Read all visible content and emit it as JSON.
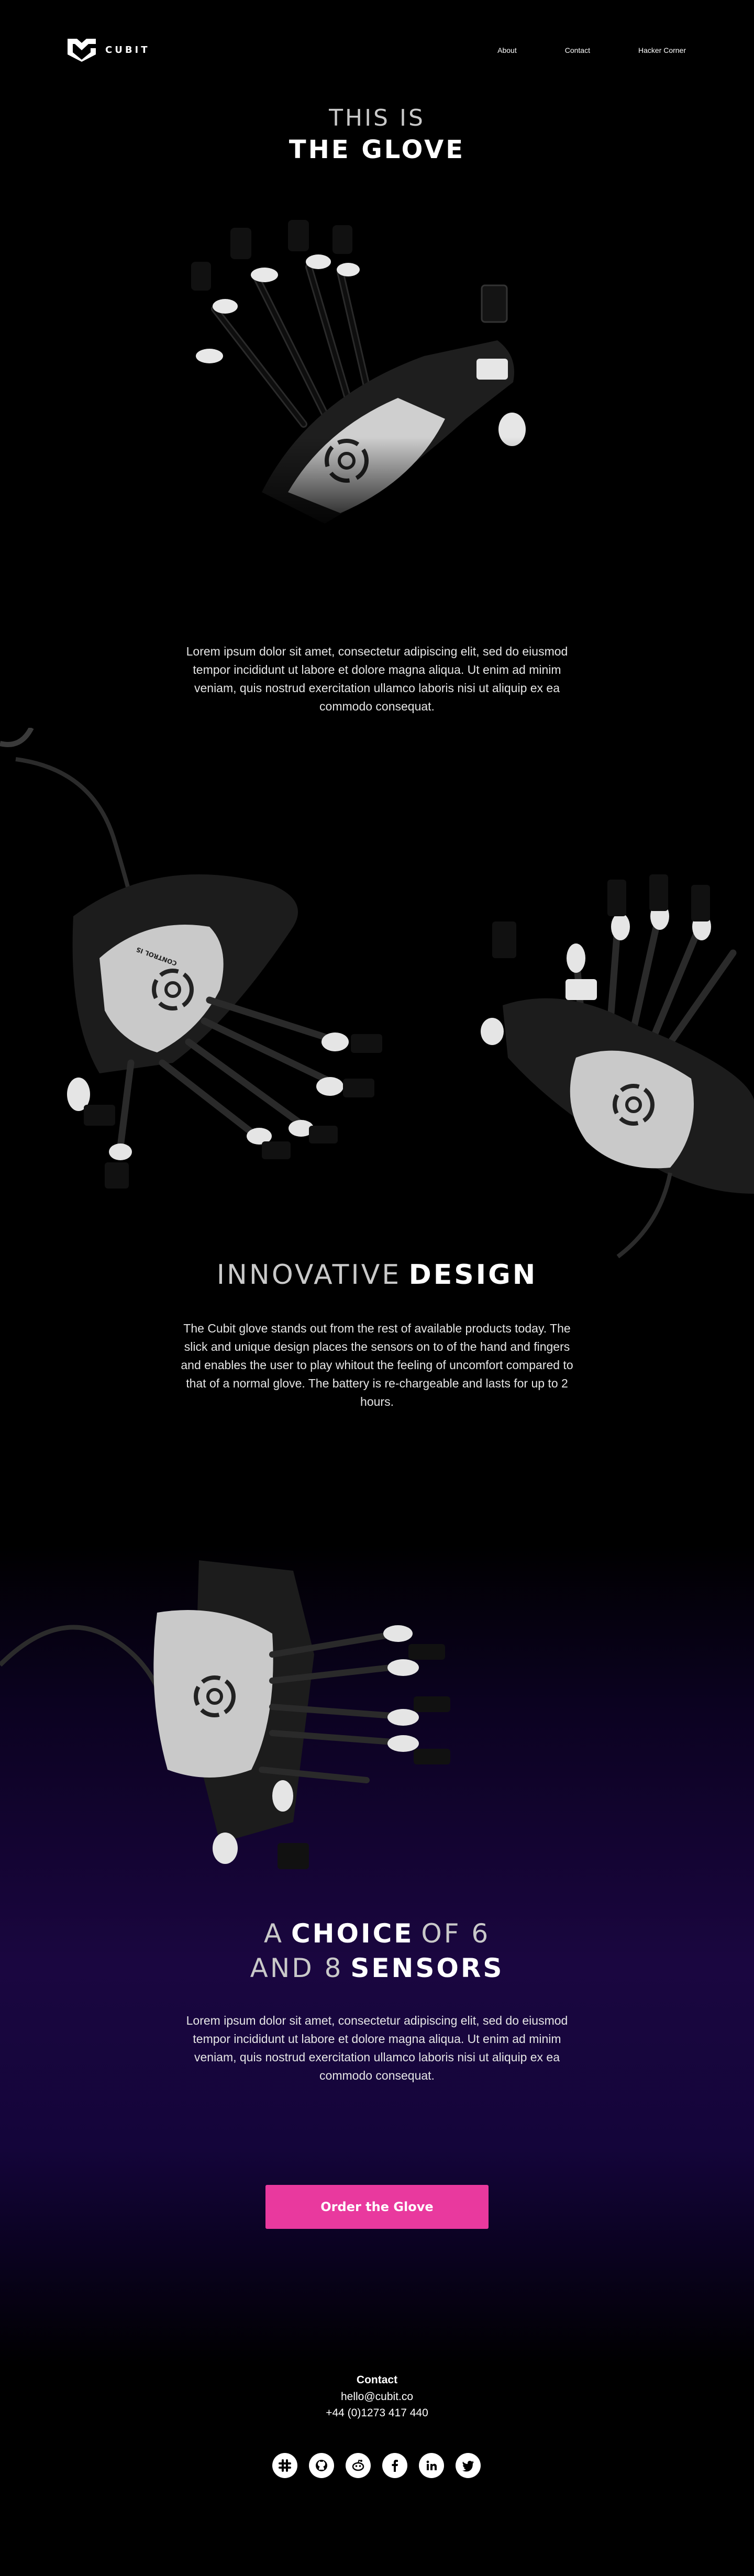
{
  "brand": {
    "name": "CUBIT"
  },
  "nav": {
    "items": [
      "About",
      "Contact",
      "Hacker Corner"
    ]
  },
  "hero": {
    "title_light": "THIS IS",
    "title_bold": "THE GLOVE",
    "paragraph": "Lorem ipsum dolor sit amet, consectetur adipiscing elit, sed do eiusmod tempor incididunt ut labore et dolore magna aliqua. Ut enim ad minim veniam, quis nostrud exercitation ullamco laboris nisi ut aliquip ex ea commodo consequat."
  },
  "design": {
    "title_light": "INNOVATIVE",
    "title_bold": "DESIGN",
    "paragraph": "The Cubit glove stands out from the rest of available products today. The slick and unique design places the sensors on to of the hand and fingers and enables the user to play whitout the feeling of uncomfort compared to that of a normal glove. The battery is re-chargeable and lasts for up to 2 hours."
  },
  "sensors": {
    "title_light_1": "A",
    "title_bold_1": "CHOICE",
    "title_light_2": "OF 6",
    "title_light_3": "AND 8",
    "title_bold_2": "SENSORS",
    "paragraph": "Lorem ipsum dolor sit amet, consectetur adipiscing elit, sed do eiusmod tempor incididunt ut labore et dolore magna aliqua. Ut enim ad minim veniam, quis nostrud exercitation ullamco laboris nisi ut aliquip ex ea commodo consequat."
  },
  "cta": {
    "label": "Order the Glove",
    "color": "#e9399e"
  },
  "contact": {
    "title": "Contact",
    "email": "hello@cubit.co",
    "phone": "+44 (0)1273 417 440"
  },
  "social": [
    "slack-icon",
    "github-icon",
    "reddit-icon",
    "facebook-icon",
    "linkedin-icon",
    "twitter-icon"
  ],
  "product_badge_text": "CONTROL IS"
}
